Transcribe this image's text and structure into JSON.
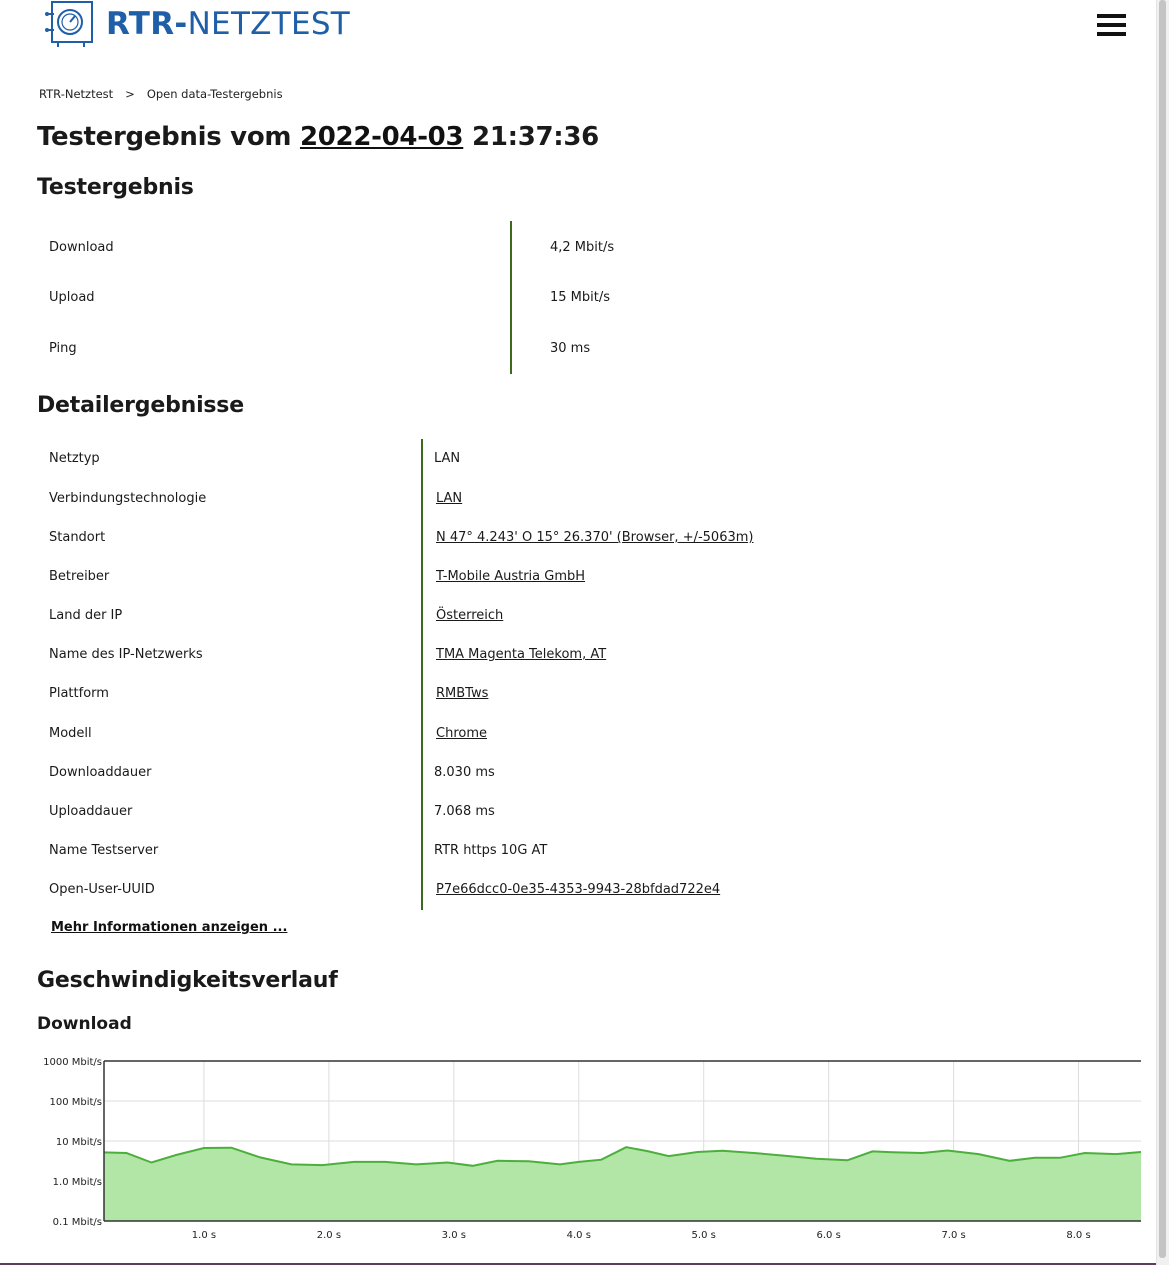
{
  "header": {
    "logo_text_bold": "RTR-",
    "logo_text_light": "NETZTEST"
  },
  "breadcrumb": {
    "items": [
      "RTR-Netztest",
      "Open data-Testergebnis"
    ],
    "separator": ">"
  },
  "title": {
    "prefix": "Testergebnis vom",
    "date": "2022-04-03",
    "time": "21:37:36"
  },
  "result": {
    "heading": "Testergebnis",
    "rows": [
      {
        "label": "Download",
        "value": "4,2 Mbit/s"
      },
      {
        "label": "Upload",
        "value": "15 Mbit/s"
      },
      {
        "label": "Ping",
        "value": "30 ms"
      }
    ]
  },
  "details": {
    "heading": "Detailergebnisse",
    "rows": [
      {
        "label": "Netztyp",
        "value": "LAN",
        "link": false
      },
      {
        "label": "Verbindungstechnologie",
        "value": "LAN",
        "link": true
      },
      {
        "label": "Standort",
        "value": "N 47° 4.243' O 15° 26.370' (Browser, +/-5063m)",
        "link": true
      },
      {
        "label": "Betreiber",
        "value": "T-Mobile Austria GmbH",
        "link": true
      },
      {
        "label": "Land der IP",
        "value": "Österreich",
        "link": true
      },
      {
        "label": "Name des IP-Netzwerks",
        "value": "TMA Magenta Telekom, AT",
        "link": true
      },
      {
        "label": "Plattform",
        "value": "RMBTws",
        "link": true
      },
      {
        "label": "Modell",
        "value": "Chrome",
        "link": true
      },
      {
        "label": "Downloaddauer",
        "value": "8.030 ms",
        "link": false
      },
      {
        "label": "Uploaddauer",
        "value": "7.068 ms",
        "link": false
      },
      {
        "label": "Name Testserver",
        "value": "RTR https 10G AT",
        "link": false
      },
      {
        "label": "Open-User-UUID",
        "value": "P7e66dcc0-0e35-4353-9943-28bfdad722e4",
        "link": true
      }
    ],
    "more_label": "Mehr Informationen anzeigen ..."
  },
  "speed_section": {
    "heading": "Geschwindigkeitsverlauf",
    "subheading": "Download"
  },
  "chart_data": {
    "type": "area",
    "yscale": "log",
    "ylim": [
      0.1,
      1000
    ],
    "xlim": [
      0.2,
      8.5
    ],
    "yticks": [
      "0.1 Mbit/s",
      "1.0 Mbit/s",
      "10 Mbit/s",
      "100 Mbit/s",
      "1000 Mbit/s"
    ],
    "ytick_values": [
      0.1,
      1,
      10,
      100,
      1000
    ],
    "xticks": [
      "1.0 s",
      "2.0 s",
      "3.0 s",
      "4.0 s",
      "5.0 s",
      "6.0 s",
      "7.0 s",
      "8.0 s"
    ],
    "xtick_values": [
      1,
      2,
      3,
      4,
      5,
      6,
      7,
      8
    ],
    "grid": true,
    "fill_color": "#b2e6a6",
    "line_color": "#4caf3c",
    "series": [
      {
        "x": [
          0.2,
          0.38,
          0.58,
          0.78,
          1.0,
          1.22,
          1.45,
          1.7,
          1.95,
          2.2,
          2.45,
          2.7,
          2.95,
          3.15,
          3.35,
          3.6,
          3.85,
          4.0,
          4.18,
          4.38,
          4.55,
          4.72,
          4.95,
          5.15,
          5.4,
          5.65,
          5.9,
          6.15,
          6.35,
          6.55,
          6.75,
          6.95,
          7.2,
          7.45,
          7.65,
          7.85,
          8.05,
          8.3,
          8.5
        ],
        "y": [
          5.2,
          5.0,
          2.9,
          4.5,
          6.7,
          6.8,
          3.9,
          2.6,
          2.5,
          3.0,
          3.0,
          2.6,
          2.9,
          2.4,
          3.2,
          3.1,
          2.6,
          3.0,
          3.4,
          7.0,
          5.6,
          4.2,
          5.3,
          5.7,
          5.0,
          4.3,
          3.6,
          3.3,
          5.5,
          5.2,
          5.0,
          5.8,
          4.7,
          3.2,
          3.8,
          3.8,
          5.0,
          4.7,
          5.3
        ]
      }
    ]
  }
}
